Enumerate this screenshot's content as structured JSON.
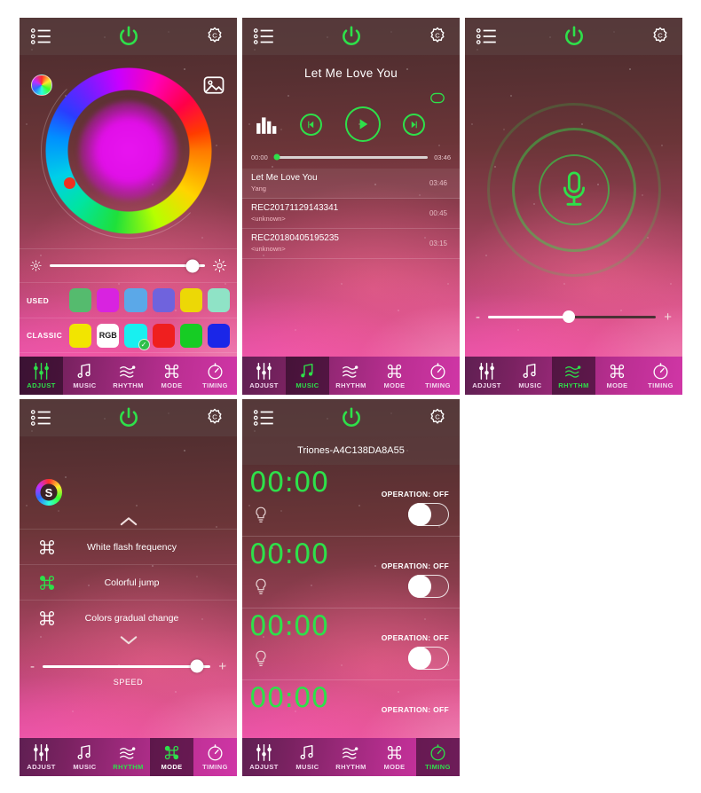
{
  "app": {
    "accent_green": "#2ee04a",
    "nav_labels": [
      "ADJUST",
      "MUSIC",
      "RHYTHM",
      "MODE",
      "TIMING"
    ],
    "nav_icons": [
      "sliders-icon",
      "music-note-icon",
      "sound-wave-icon",
      "command-loop-icon",
      "stopwatch-icon"
    ]
  },
  "header": {
    "menu_icon": "list-menu-icon",
    "power_icon": "power-icon",
    "settings_icon": "gear-icon"
  },
  "panel_adjust": {
    "active_tab": "ADJUST",
    "color_wheel_icon": "color-wheel-icon",
    "image_picker_icon": "image-picker-icon",
    "selected_color": "#e10fe8",
    "hue_knob_color": "#f03020",
    "brightness": {
      "low_icon": "brightness-low-icon",
      "high_icon": "brightness-high-icon",
      "value": 92
    },
    "used": {
      "label": "USED",
      "colors": [
        "#55bb6e",
        "#d823e0",
        "#5ba8e8",
        "#6f63dd",
        "#ecd806",
        "#8fe3c6"
      ]
    },
    "classic": {
      "label": "CLASSIC",
      "colors": [
        "#f2e500",
        "#ffffff",
        "#18f0f0",
        "#ef1f1f",
        "#16cc24",
        "#1a26e8"
      ],
      "rgb_label": "RGB",
      "selected_index": 2,
      "check_glyph": "✓"
    }
  },
  "panel_music": {
    "active_tab": "MUSIC",
    "now_playing": "Let Me Love You",
    "loop_icon": "loop-icon",
    "equalizer_icon": "equalizer-icon",
    "prev_icon": "previous-track-icon",
    "play_icon": "play-icon",
    "next_icon": "next-track-icon",
    "elapsed": "00:00",
    "duration": "03:46",
    "progress": 2,
    "tracks": [
      {
        "name": "Let Me Love You",
        "artist": "Yang",
        "duration": "03:46",
        "selected": true
      },
      {
        "name": "REC20171129143341",
        "artist": "<unknown>",
        "duration": "00:45",
        "selected": false
      },
      {
        "name": "REC20180405195235",
        "artist": "<unknown>",
        "duration": "03:15",
        "selected": false
      }
    ]
  },
  "panel_rhythm": {
    "active_tab": "RHYTHM",
    "mic_icon": "microphone-icon",
    "sensitivity": {
      "minus_label": "-",
      "plus_label": "+",
      "value": 48
    }
  },
  "panel_mode": {
    "active_tab": "MODE",
    "speed_badge": "S",
    "badge_icon": "color-wheel-icon",
    "scroll_up_icon": "chevron-up-icon",
    "scroll_down_icon": "chevron-down-icon",
    "modes": [
      {
        "label": "White flash frequency",
        "icon": "command-loop-icon",
        "active": false
      },
      {
        "label": "Colorful jump",
        "icon": "command-loop-icon",
        "active": true
      },
      {
        "label": "Colors gradual change",
        "icon": "command-loop-icon",
        "active": false
      }
    ],
    "speed": {
      "label": "SPEED",
      "minus_label": "-",
      "plus_label": "+",
      "value": 92
    }
  },
  "panel_timing": {
    "active_tab": "TIMING",
    "device_name": "Triones-A4C138DA8A55",
    "bulb_icon": "bulb-icon",
    "timers": [
      {
        "time": "00:00",
        "operation": "OPERATION: OFF",
        "enabled": false
      },
      {
        "time": "00:00",
        "operation": "OPERATION: OFF",
        "enabled": false
      },
      {
        "time": "00:00",
        "operation": "OPERATION: OFF",
        "enabled": false
      },
      {
        "time": "00:00",
        "operation": "OPERATION: OFF",
        "enabled": false
      }
    ]
  }
}
